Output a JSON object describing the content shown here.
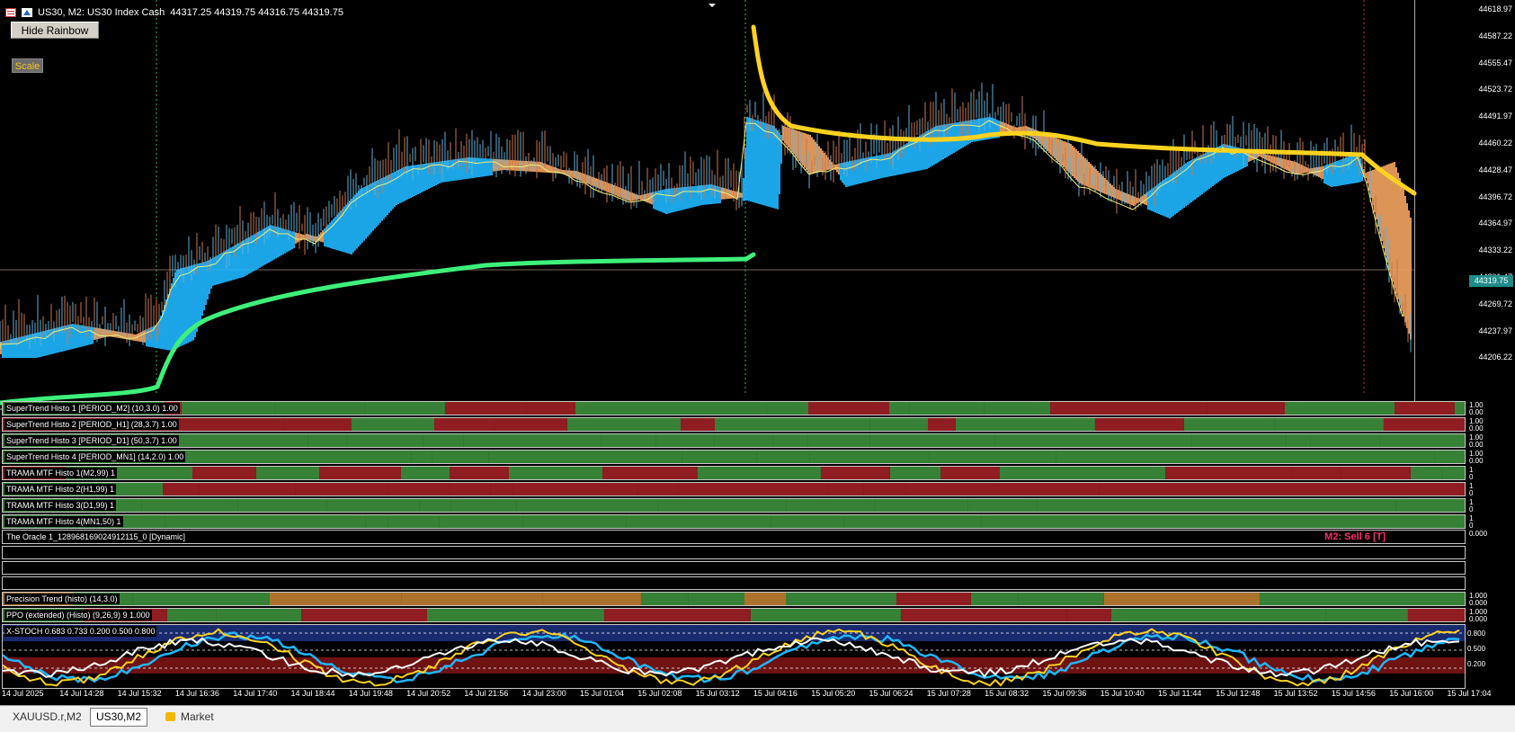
{
  "chart": {
    "symbol_line": "US30, M2:  US30 Index Cash",
    "ohlc": "44317.25 44319.75 44316.75 44319.75",
    "hide_rainbow_label": "Hide Rainbow",
    "scale_label": "Scale",
    "current_price": "44319.75",
    "price_labels": [
      "44618.97",
      "44587.22",
      "44555.47",
      "44523.72",
      "44491.97",
      "44460.22",
      "44428.47",
      "44396.72",
      "44364.97",
      "44333.22",
      "44301.47",
      "44269.72",
      "44237.97",
      "44206.22"
    ],
    "colors": {
      "bull": "#1fb7ff",
      "bear": "#f4a460",
      "gold": "#ffd21f",
      "green": "#3ef07a",
      "hist_green": "#3a8a3a",
      "hist_red": "#9a1f24",
      "hist_orange": "#b87a2f"
    }
  },
  "indicators": [
    {
      "label": "SuperTrend Histo 1 [PERIOD_M2] (10,3.0) 1.00",
      "right": "1.00 0.00"
    },
    {
      "label": "SuperTrend Histo 2 [PERIOD_H1] (28,3.7) 1.00",
      "right": "1.00 0.00"
    },
    {
      "label": "SuperTrend Histo 3 [PERIOD_D1] (50,3.7) 1.00",
      "right": "1.00 0.00"
    },
    {
      "label": "SuperTrend Histo 4 [PERIOD_MN1] (14,2.0) 1.00",
      "right": "1.00 0.00"
    },
    {
      "label": "TRAMA MTF Histo 1(M2,99) 1",
      "right": "1 0"
    },
    {
      "label": "TRAMA MTF Histo 2(H1,99) 1",
      "right": "1 0"
    },
    {
      "label": "TRAMA MTF Histo 3(D1,99) 1",
      "right": "1 0"
    },
    {
      "label": "TRAMA MTF Histo 4(MN1,50) 1",
      "right": "1 0"
    }
  ],
  "oracle": {
    "label": "The Oracle 1_128968169024912115_0 [Dynamic]",
    "signal": "M2: Sell 6 [T]",
    "right": "0.000"
  },
  "precision_trend": {
    "label": "Precision Trend (histo) (14,3.0)",
    "right": "1.000 0.000"
  },
  "ppo": {
    "label": "PPO (extended) (Histo) (9,26,9) 9 1.000",
    "right": "1.000 0.000"
  },
  "xstoch": {
    "label": "X-STOCH 0.683 0.733 0.200 0.500 0.800",
    "levels": [
      "0.800",
      "0.500",
      "0.200"
    ]
  },
  "time_labels": [
    "14 Jul 2025",
    "14 Jul 14:28",
    "14 Jul 15:32",
    "14 Jul 16:36",
    "14 Jul 17:40",
    "14 Jul 18:44",
    "14 Jul 19:48",
    "14 Jul 20:52",
    "14 Jul 21:56",
    "14 Jul 23:00",
    "15 Jul 01:04",
    "15 Jul 02:08",
    "15 Jul 03:12",
    "15 Jul 04:16",
    "15 Jul 05:20",
    "15 Jul 06:24",
    "15 Jul 07:28",
    "15 Jul 08:32",
    "15 Jul 09:36",
    "15 Jul 10:40",
    "15 Jul 11:44",
    "15 Jul 12:48",
    "15 Jul 13:52",
    "15 Jul 14:56",
    "15 Jul 16:00",
    "15 Jul 17:04"
  ],
  "tabs": [
    {
      "label": "XAUUSD.r,M2",
      "active": false
    },
    {
      "label": "US30,M2",
      "active": true
    },
    {
      "label": "Market",
      "active": false
    }
  ]
}
